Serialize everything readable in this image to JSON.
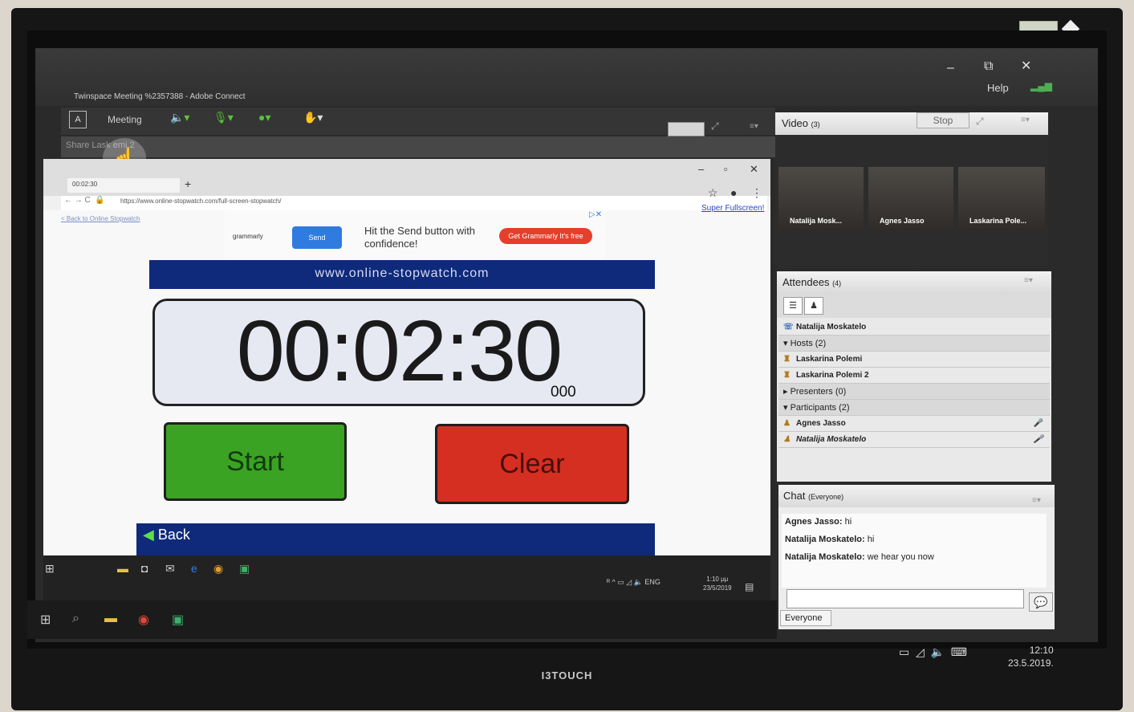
{
  "monitor": {
    "brand": "I3TOUCH"
  },
  "window": {
    "title": "Twinspace Meeting %2357388 - Adobe Connect",
    "help": "Help",
    "minimize": "–",
    "restore": "⧉",
    "close": "✕"
  },
  "toolbar": {
    "logo": "A",
    "meeting": "Meeting"
  },
  "share": {
    "text": "Share  Lask   emi 2"
  },
  "browser": {
    "tab_title": "00:02:30",
    "new_tab": "+",
    "url": "https://www.online-stopwatch.com/full-screen-stopwatch/",
    "back_link": "< Back to Online Stopwatch",
    "super_fullscreen": "Super Fullscreen!"
  },
  "ad": {
    "brand": "grammarly",
    "send": "Send",
    "text": "Hit the Send button with confidence!",
    "button": "Get Grammarly It's free",
    "close": "▷✕"
  },
  "stopwatch": {
    "site": "www.online-stopwatch.com",
    "time": "00:02:30",
    "ms": "000",
    "start": "Start",
    "clear": "Clear",
    "back": "Back"
  },
  "inner_tray": {
    "lang": "ENG",
    "time": "1:10 μμ",
    "date": "23/5/2019"
  },
  "video": {
    "title": "Video",
    "count": "(3)",
    "stop": "Stop",
    "tiles": [
      "Natalija Mosk...",
      "Agnes Jasso",
      "Laskarina Pole..."
    ]
  },
  "attendees": {
    "title": "Attendees",
    "count": "(4)",
    "phone_user": "Natalija Moskatelo",
    "hosts_label": "Hosts (2)",
    "hosts": [
      "Laskarina Polemi",
      "Laskarina Polemi 2"
    ],
    "presenters_label": "Presenters (0)",
    "participants_label": "Participants (2)",
    "participants": [
      "Agnes Jasso",
      "Natalija Moskatelo"
    ]
  },
  "chat": {
    "title": "Chat",
    "scope": "(Everyone)",
    "messages": [
      {
        "author": "Agnes Jasso:",
        "text": " hi"
      },
      {
        "author": "Natalija Moskatelo:",
        "text": " hi"
      },
      {
        "author": "Natalija Moskatelo:",
        "text": " we hear you now"
      }
    ],
    "everyone_tab": "Everyone"
  },
  "outer_tray": {
    "time": "12:10",
    "date": "23.5.2019."
  },
  "colors": {
    "start": "#3aa323",
    "clear": "#d52f22",
    "site_bar": "#0f2a7a"
  }
}
